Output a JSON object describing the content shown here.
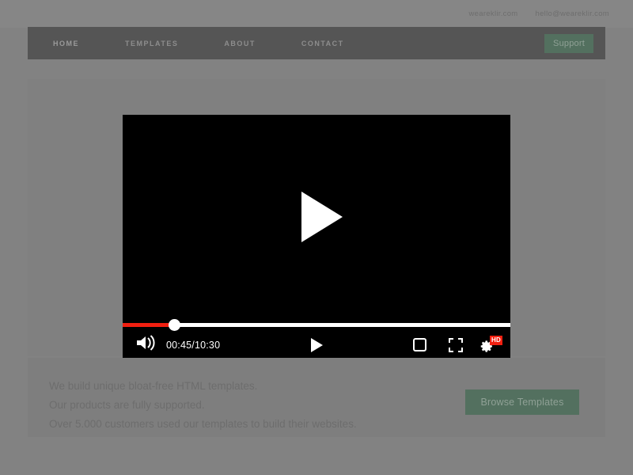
{
  "topbar": {
    "site_url": "weareklir.com",
    "email": "hello@weareklir.com"
  },
  "nav": {
    "items": [
      {
        "label": "HOME"
      },
      {
        "label": "TEMPLATES"
      },
      {
        "label": "ABOUT"
      },
      {
        "label": "CONTACT"
      }
    ],
    "support_label": "Support",
    "support_color": "#53705f"
  },
  "video": {
    "big_play_icon": "play-icon",
    "volume_icon": "speaker-volume-icon",
    "time_display": "00:45/10:30",
    "current_time": "00:45",
    "duration": "10:30",
    "progress_percent": 13.5,
    "play_icon": "play-icon",
    "miniplayer_icon": "miniplayer-icon",
    "fullscreen_icon": "fullscreen-icon",
    "settings_icon": "gear-icon",
    "quality_badge": "HD",
    "progress_color": "#f11f10",
    "badge_color": "#f11f10"
  },
  "bottom": {
    "lines": [
      "We build unique bloat-free HTML templates.",
      "Our products are fully supported.",
      "Over 5.000 customers used our templates to build their websites."
    ],
    "cta_label": "Browse Templates",
    "cta_color": "#53705f"
  }
}
